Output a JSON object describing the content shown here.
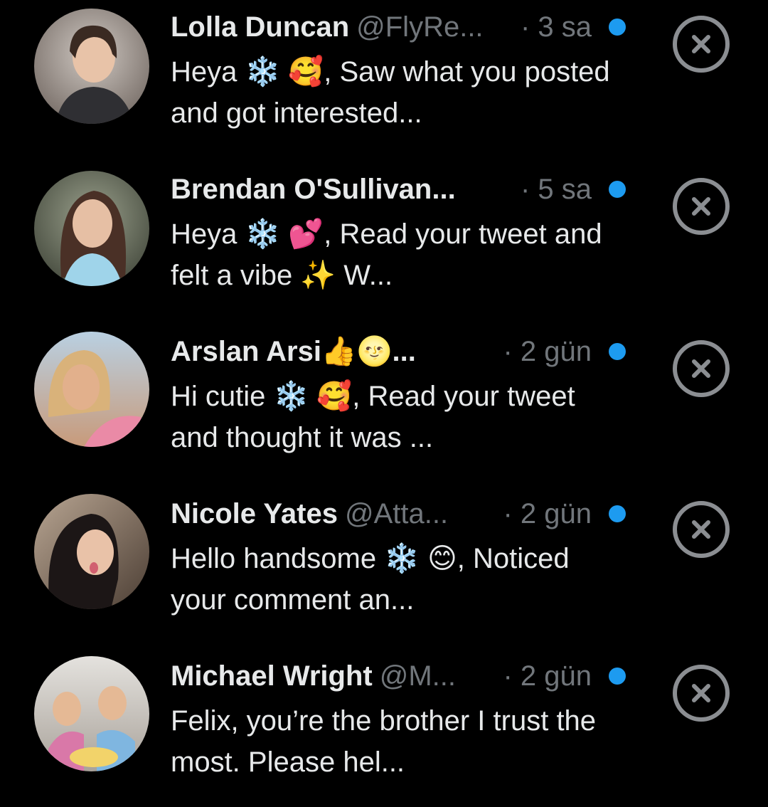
{
  "colors": {
    "background": "#000000",
    "name_text": "#e7e9ea",
    "secondary_text": "#71767b",
    "unread_dot": "#1d9bf0",
    "close_icon": "#8b8e92"
  },
  "messages": [
    {
      "name": "Lolla Duncan",
      "handle": "@FlyRe...",
      "time": "· 3 sa",
      "text": "Heya ❄️ 🥰, Saw what you posted and got interested...",
      "unread": true,
      "avatar_icon": "avatar-photo-icon"
    },
    {
      "name": "Brendan O'Sullivan...",
      "handle": "",
      "time": "· 5 sa",
      "text": "Heya ❄️ 💕, Read your tweet and felt a vibe ✨ W...",
      "unread": true,
      "avatar_icon": "avatar-photo-icon"
    },
    {
      "name": "Arslan Arsi👍🌝...",
      "handle": "",
      "time": "· 2 gün",
      "text": "Hi cutie ❄️ 🥰, Read your tweet and thought it was ...",
      "unread": true,
      "avatar_icon": "avatar-photo-icon"
    },
    {
      "name": "Nicole Yates",
      "handle": "@Atta...",
      "time": "· 2 gün",
      "text": "Hello handsome ❄️ 😊, Noticed your comment an...",
      "unread": true,
      "avatar_icon": "avatar-photo-icon"
    },
    {
      "name": "Michael Wright",
      "handle": "@M...",
      "time": "· 2 gün",
      "text": "Felix, you’re the brother I trust the most. Please hel...",
      "unread": true,
      "avatar_icon": "avatar-photo-icon"
    }
  ]
}
